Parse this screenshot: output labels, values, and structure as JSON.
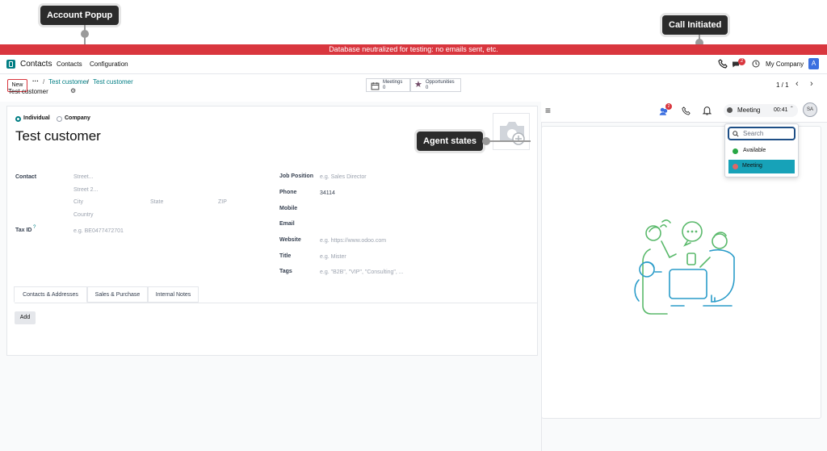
{
  "callouts": {
    "account_popup": "Account Popup",
    "call_initiated": "Call Initiated",
    "agent_states": "Agent states"
  },
  "banner": {
    "text": "Database neutralized for testing: no emails sent, etc."
  },
  "topnav": {
    "app_name": "Contacts",
    "menu": [
      "Contacts",
      "Configuration"
    ],
    "company": "My Company",
    "avatar_letter": "A",
    "chat_badge": "2"
  },
  "control": {
    "new_label": "New",
    "breadcrumb": [
      "Test customer",
      "Test customer"
    ],
    "record_name": "Test customer",
    "smart_buttons": [
      {
        "label": "Meetings",
        "count": "0"
      },
      {
        "label": "Opportunities",
        "count": "0"
      }
    ],
    "pager": "1 / 1"
  },
  "form": {
    "type_options": [
      "Individual",
      "Company"
    ],
    "name": "Test customer",
    "contact_label": "Contact",
    "address_placeholders": {
      "street": "Street...",
      "street2": "Street 2...",
      "city": "City",
      "state": "State",
      "zip": "ZIP",
      "country": "Country"
    },
    "tax_id_label": "Tax ID",
    "tax_id_help": "?",
    "tax_id_placeholder": "e.g. BE0477472701",
    "fields": [
      {
        "label": "Job Position",
        "placeholder": "e.g. Sales Director",
        "value": ""
      },
      {
        "label": "Phone",
        "placeholder": "",
        "value": "34114"
      },
      {
        "label": "Mobile",
        "placeholder": "",
        "value": ""
      },
      {
        "label": "Email",
        "placeholder": "",
        "value": ""
      },
      {
        "label": "Website",
        "placeholder": "e.g. https://www.odoo.com",
        "value": ""
      },
      {
        "label": "Title",
        "placeholder": "e.g. Mister",
        "value": ""
      },
      {
        "label": "Tags",
        "placeholder": "e.g. \"B2B\", \"VIP\", \"Consulting\", ...",
        "value": ""
      }
    ],
    "tabs": [
      "Contacts & Addresses",
      "Sales & Purchase",
      "Internal Notes"
    ],
    "add_label": "Add"
  },
  "voip": {
    "badge": "2",
    "status_label": "Meeting",
    "timer": "00:41",
    "user_initials": "SA",
    "search_placeholder": "Search",
    "states": [
      "Available",
      "Meeting"
    ]
  },
  "colors": {
    "banner": "#d9363e",
    "brand": "#017e84",
    "selected": "#17a2b8",
    "available": "#28a745",
    "meeting": "#e06666",
    "avatar": "#3b6fe0"
  }
}
